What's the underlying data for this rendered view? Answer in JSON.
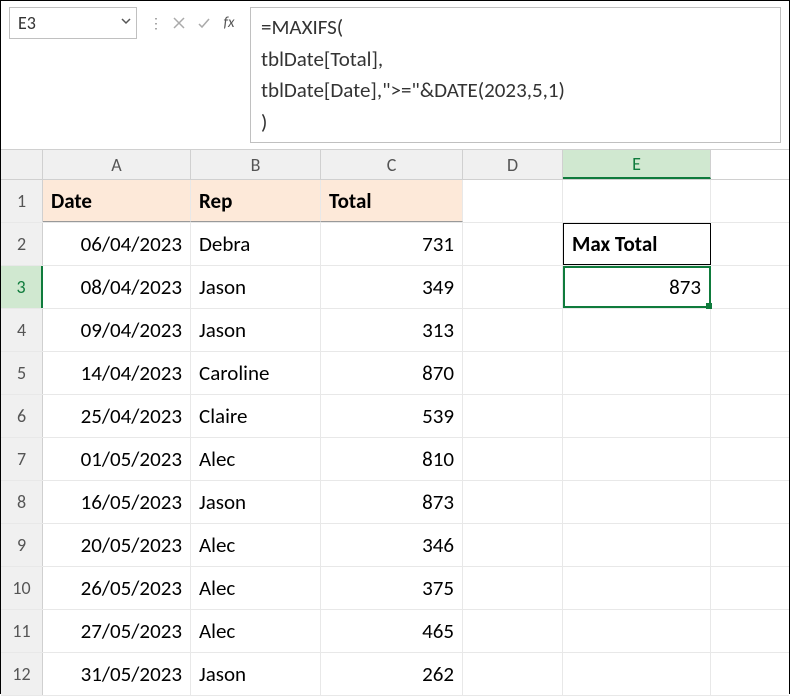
{
  "nameBox": {
    "value": "E3"
  },
  "formulaBar": {
    "line1": "=MAXIFS(",
    "line2": "tblDate[Total],",
    "line3": "tblDate[Date],\">=\"&DATE(2023,5,1)",
    "line4": ")"
  },
  "columns": [
    "A",
    "B",
    "C",
    "D",
    "E"
  ],
  "tableHeaders": {
    "A": "Date",
    "B": "Rep",
    "C": "Total"
  },
  "rows": [
    {
      "n": 2,
      "date": "06/04/2023",
      "rep": "Debra",
      "total": "731"
    },
    {
      "n": 3,
      "date": "08/04/2023",
      "rep": "Jason",
      "total": "349"
    },
    {
      "n": 4,
      "date": "09/04/2023",
      "rep": "Jason",
      "total": "313"
    },
    {
      "n": 5,
      "date": "14/04/2023",
      "rep": "Caroline",
      "total": "870"
    },
    {
      "n": 6,
      "date": "25/04/2023",
      "rep": "Claire",
      "total": "539"
    },
    {
      "n": 7,
      "date": "01/05/2023",
      "rep": "Alec",
      "total": "810"
    },
    {
      "n": 8,
      "date": "16/05/2023",
      "rep": "Jason",
      "total": "873"
    },
    {
      "n": 9,
      "date": "20/05/2023",
      "rep": "Alec",
      "total": "346"
    },
    {
      "n": 10,
      "date": "26/05/2023",
      "rep": "Alec",
      "total": "375"
    },
    {
      "n": 11,
      "date": "27/05/2023",
      "rep": "Alec",
      "total": "465"
    },
    {
      "n": 12,
      "date": "31/05/2023",
      "rep": "Jason",
      "total": "262"
    }
  ],
  "maxTotal": {
    "label": "Max Total",
    "value": "873"
  },
  "selectedCell": "E3",
  "selectedRow": 3,
  "selectedCol": "E"
}
